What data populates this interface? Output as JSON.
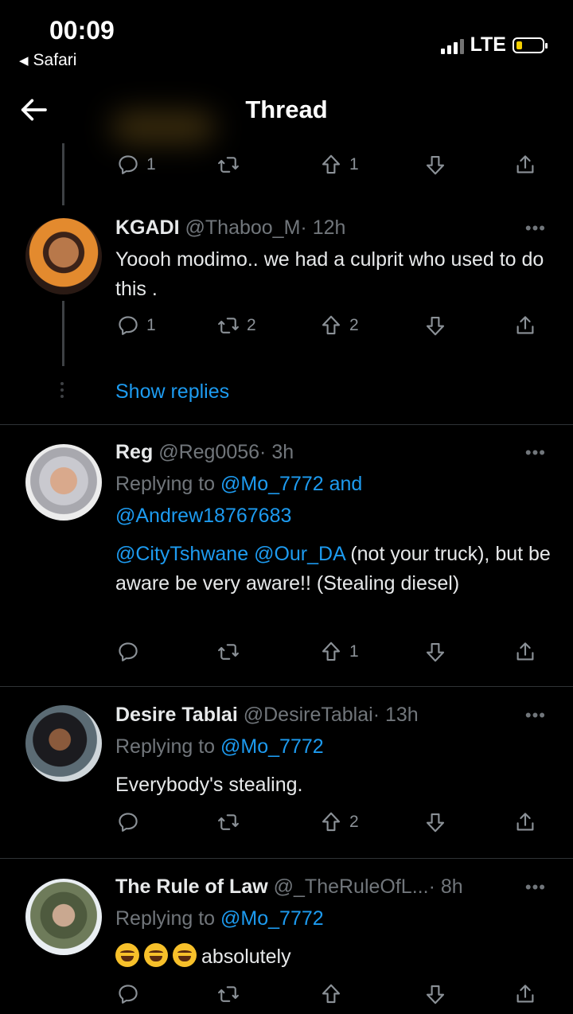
{
  "status_bar": {
    "time": "00:09",
    "back_app": "Safari",
    "network": "LTE"
  },
  "header": {
    "title": "Thread"
  },
  "top_actions": {
    "reply_count": "1",
    "retweet_count": "",
    "upvote_count": "1"
  },
  "tweets": [
    {
      "name": "KGADI",
      "handle": "@Thaboo_M",
      "time": "· 12h",
      "text": "Yoooh modimo.. we had a culprit who used to do this .",
      "reply_count": "1",
      "retweet_count": "2",
      "upvote_count": "2",
      "show_replies": "Show replies"
    },
    {
      "name": "Reg",
      "handle": "@Reg0056",
      "time": "· 3h",
      "replying_prefix": "Replying to",
      "replying_to_1": "@Mo_7772",
      "replying_and": "and",
      "replying_to_2": "@Andrew18767683",
      "mention_1": "@CityTshwane",
      "mention_2": "@Our_DA",
      "text_after": "(not your truck), but be aware be very aware!! (Stealing diesel)",
      "reply_count": "",
      "retweet_count": "",
      "upvote_count": "1"
    },
    {
      "name": "Desire Tablai",
      "handle": "@DesireTablai",
      "time": "· 13h",
      "replying_prefix": "Replying to",
      "replying_to_1": "@Mo_7772",
      "text": "Everybody's stealing.",
      "reply_count": "",
      "retweet_count": "",
      "upvote_count": "2"
    },
    {
      "name": "The Rule of Law",
      "handle": "@_TheRuleOfL...",
      "time": "· 8h",
      "replying_prefix": "Replying to",
      "replying_to_1": "@Mo_7772",
      "text": "absolutely",
      "emoji": "rolling-on-floor-laughing",
      "reply_count": "",
      "retweet_count": "",
      "upvote_count": ""
    }
  ],
  "colors": {
    "background": "#000000",
    "accent": "#1d9bf0",
    "muted": "#71767b",
    "battery": "#f5d000"
  }
}
